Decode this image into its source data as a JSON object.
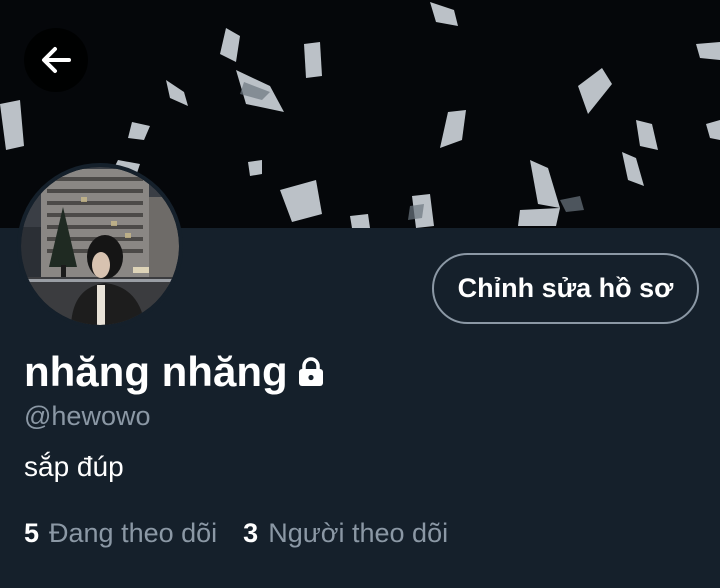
{
  "header": {
    "back_icon": "arrow-left-icon"
  },
  "profile": {
    "display_name": "nhăng nhăng",
    "protected_icon": "lock-icon",
    "handle": "@hewowo",
    "bio": "sắp đúp",
    "edit_button_label": "Chỉnh sửa hồ sơ"
  },
  "stats": {
    "following_count": "5",
    "following_label": "Đang theo dõi",
    "followers_count": "3",
    "followers_label": "Người theo dõi"
  },
  "colors": {
    "background": "#15202b",
    "secondary_text": "#8b98a5",
    "button_border": "#8b98a5"
  }
}
